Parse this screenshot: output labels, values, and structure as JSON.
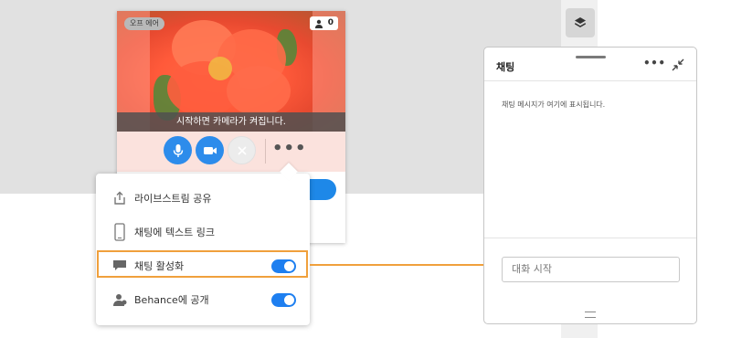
{
  "live_card": {
    "status_badge": "오프 에어",
    "viewer_count": "0",
    "camera_notice": "시작하면 카메라가 켜집니다.",
    "more_label": "•••"
  },
  "menu": {
    "items": [
      {
        "label": "라이브스트림 공유",
        "icon": "share-icon"
      },
      {
        "label": "채팅에 텍스트 링크",
        "icon": "phone-icon"
      },
      {
        "label": "채팅 활성화",
        "icon": "chat-bubble-icon",
        "toggle": true
      },
      {
        "label": "Behance에 공개",
        "icon": "behance-user-icon",
        "toggle": true
      }
    ]
  },
  "chat": {
    "title": "채팅",
    "more_label": "•••",
    "empty_message": "채팅 메시지가 여기에 표시됩니다.",
    "input_placeholder": "대화 시작"
  },
  "colors": {
    "accent": "#1e7ff0",
    "highlight": "#f0a03c"
  }
}
